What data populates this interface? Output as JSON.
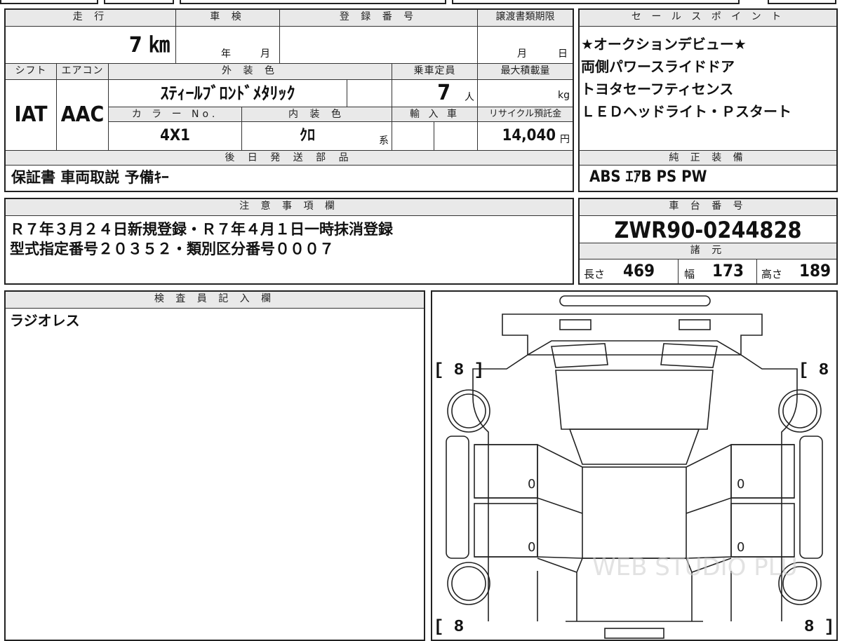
{
  "main": {
    "headers": {
      "mileage": "走 行",
      "inspection": "車 検",
      "registration": "登 録 番 号",
      "transfer_deadline": "譲渡書類期限",
      "shift": "シフト",
      "aircon": "エアコン",
      "exterior_color": "外 装 色",
      "capacity": "乗車定員",
      "max_load": "最大積載量",
      "color_no": "カ ラ ー No.",
      "interior_color": "内 装 色",
      "import": "輸 入 車",
      "recycle": "リサイクル預託金",
      "later_parts": "後 日 発 送 部 品"
    },
    "mileage_value": "7 ㎞",
    "inspection_year": "年",
    "inspection_month": "月",
    "transfer_month": "月",
    "transfer_day": "日",
    "shift_value": "IAT",
    "aircon_value": "AAC",
    "exterior_color_value": "ｽﾃｨｰﾙﾌﾞﾛﾝﾄﾞﾒﾀﾘｯｸ",
    "capacity_value": "7",
    "capacity_unit": "人",
    "max_load_unit": "kg",
    "color_no_value": "4X1",
    "interior_color_value": "ｸﾛ",
    "interior_suffix": "系",
    "recycle_value": "14,040",
    "recycle_unit": "円",
    "later_parts_value": "保証書 車両取説 予備ｷｰ"
  },
  "sales": {
    "header": "セ ー ル ス ポ イ ン ト",
    "lines": [
      "★オークションデビュー★",
      "両側パワースライドドア",
      "トヨタセーフティセンス",
      "ＬＥＤヘッドライト・Ｐスタート"
    ],
    "equipment_header": "純 正 装 備",
    "equipment_value": "ABS ｴｱB PS PW"
  },
  "notes": {
    "header": "注 意 事 項 欄",
    "lines": [
      "Ｒ７年３月２４日新規登録・Ｒ７年４月１日一時抹消登録",
      "型式指定番号２０３５２・類別区分番号０００７"
    ]
  },
  "chassis": {
    "header": "車 台 番 号",
    "value": "ZWR90-0244828",
    "spec_header": "諸 元",
    "length_label": "長さ",
    "length_value": "469",
    "width_label": "幅",
    "width_value": "173",
    "height_label": "高さ",
    "height_value": "189"
  },
  "inspector": {
    "header": "検 査 員 記 入 欄",
    "text": "ラジオレス"
  },
  "diagram": {
    "tire_front_left": "[ 8 ]",
    "tire_front_right": "[ 8 ]",
    "tire_rear_left": "[ 8",
    "tire_rear_right": "8 ]",
    "door_marks": [
      "0",
      "0",
      "0",
      "0"
    ],
    "watermark": "WEB STUDIO PLU"
  }
}
